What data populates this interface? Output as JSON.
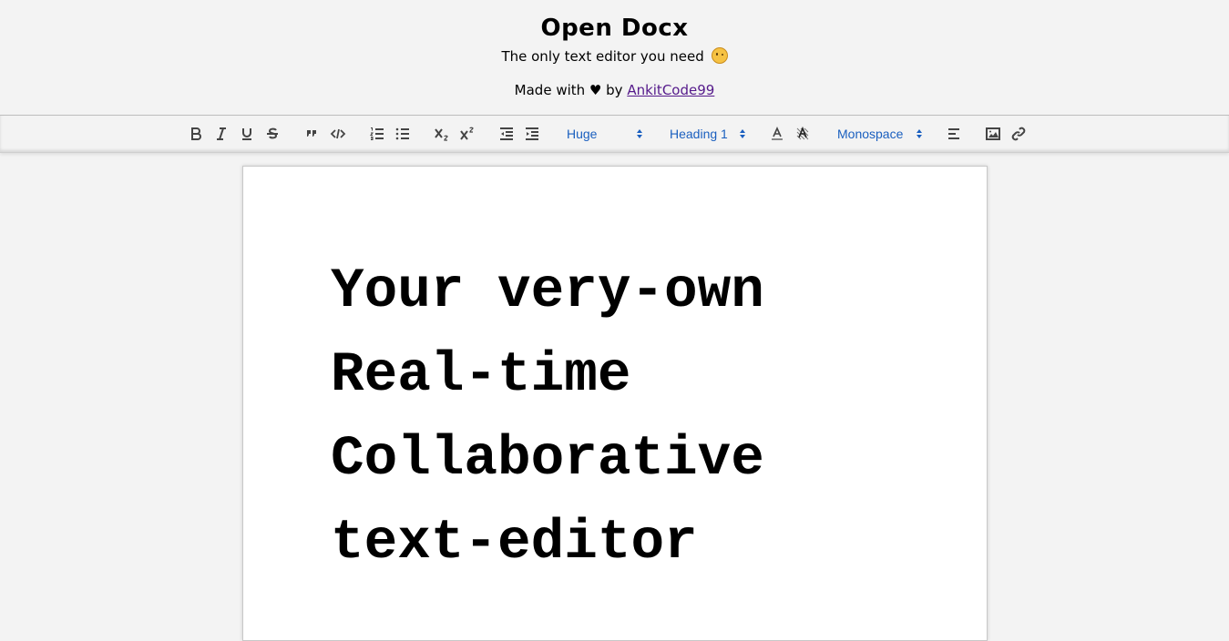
{
  "header": {
    "title": "Open Docx",
    "tagline": "The only text editor you need",
    "made_with_prefix": "Made with ♥ by",
    "author_link": "AnkitCode99"
  },
  "toolbar": {
    "size_picker": "Huge",
    "header_picker": "Heading 1",
    "font_picker": "Monospace",
    "icons": [
      "bold-icon",
      "italic-icon",
      "underline-icon",
      "strike-icon",
      "blockquote-icon",
      "code-icon",
      "ordered-list-icon",
      "bullet-list-icon",
      "subscript-icon",
      "superscript-icon",
      "outdent-icon",
      "indent-icon",
      "text-color-icon",
      "background-color-icon",
      "align-icon",
      "image-icon",
      "link-icon"
    ],
    "accent_color": "#1a5fbf"
  },
  "document": {
    "lines": [
      "Your very-own",
      "Real-time",
      "Collaborative",
      "text-editor"
    ]
  }
}
